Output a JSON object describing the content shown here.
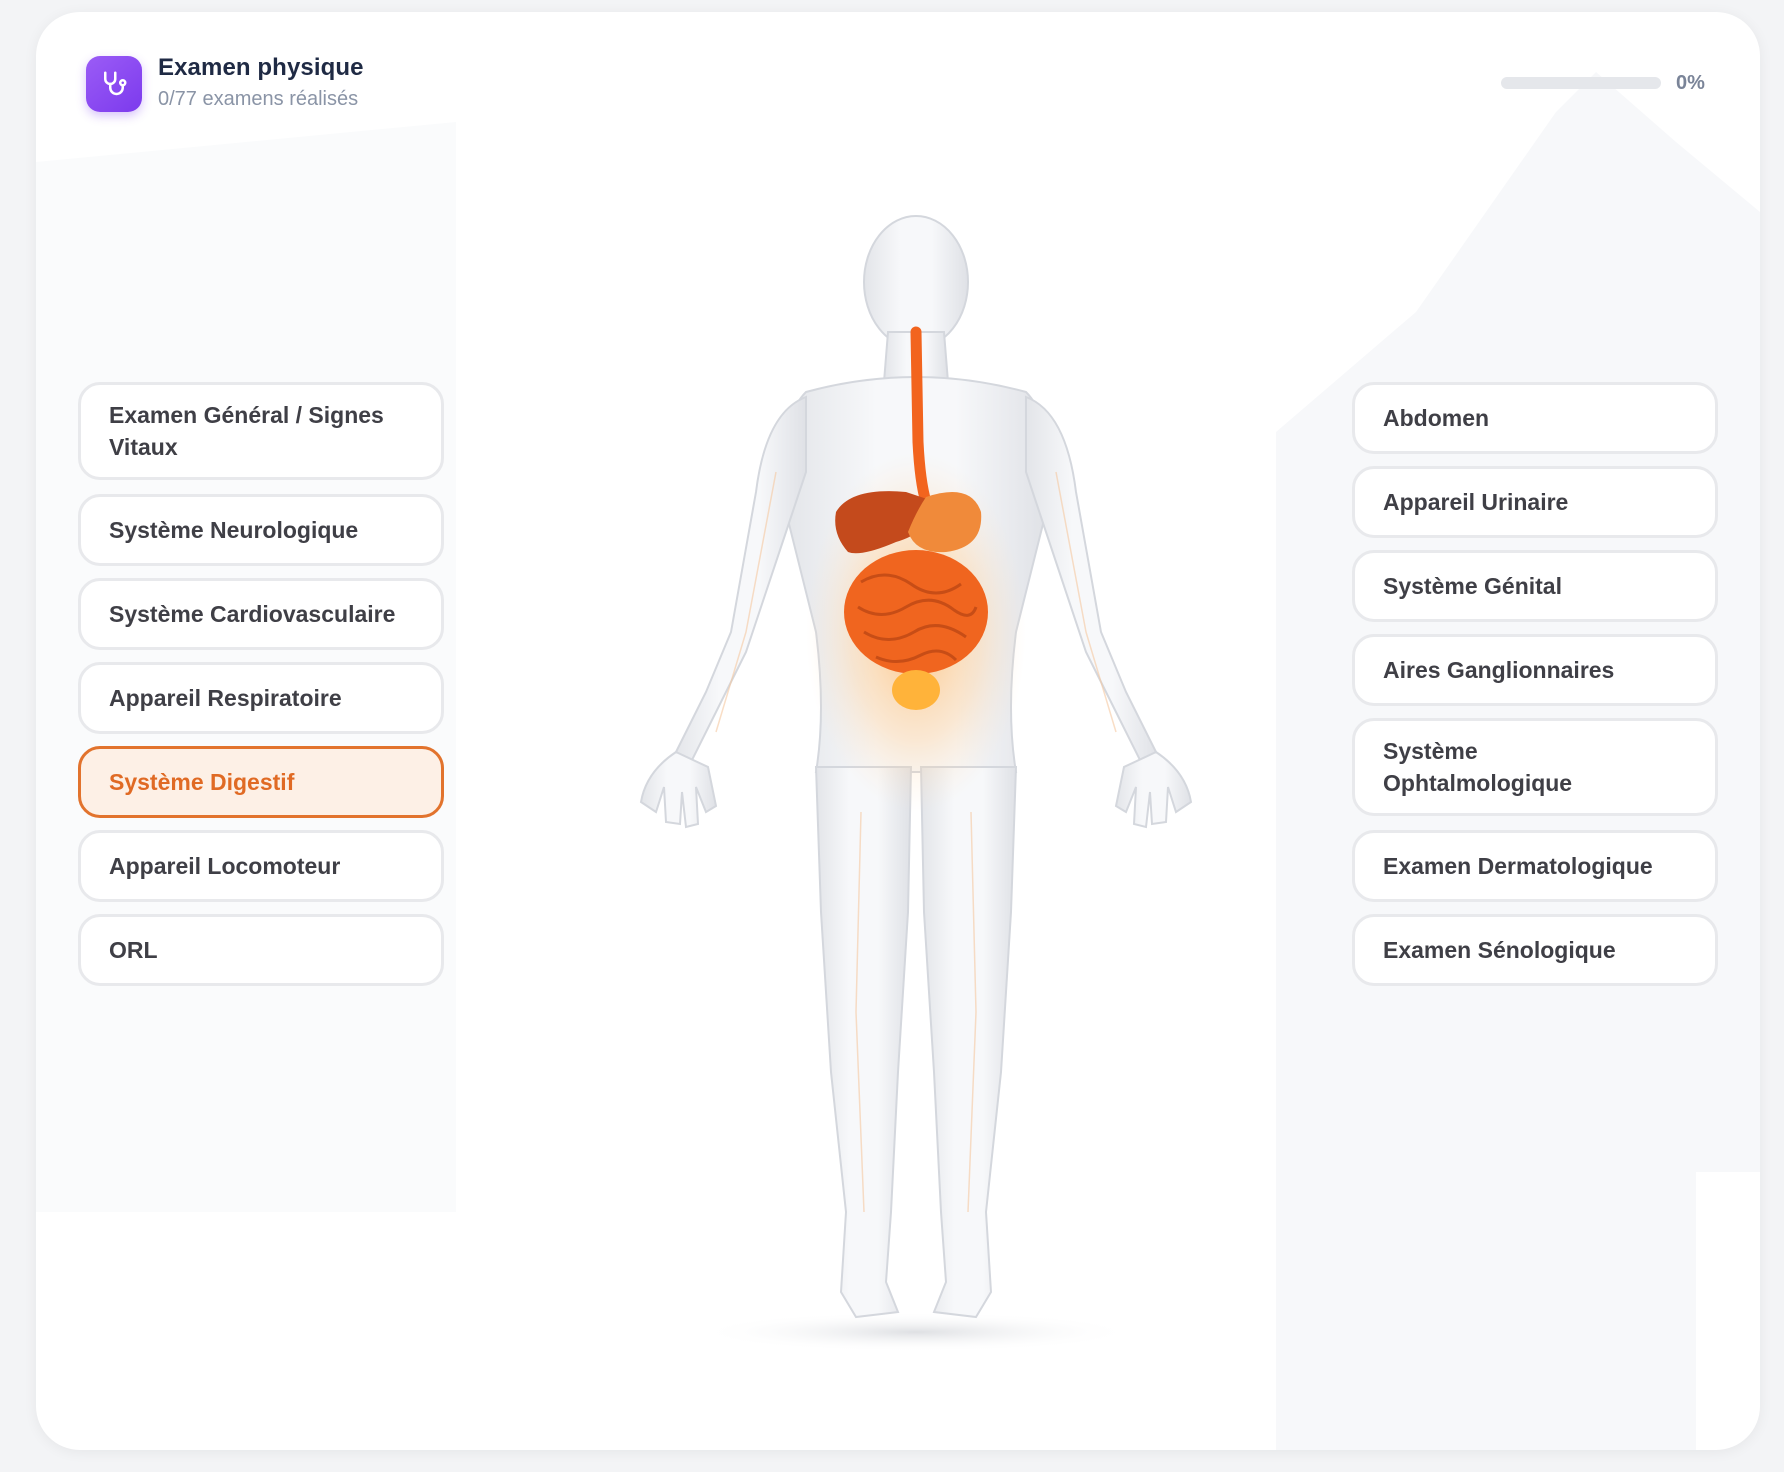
{
  "header": {
    "title": "Examen physique",
    "subtitle": "0/77 examens réalisés",
    "icon": "stethoscope-icon",
    "accent_color": "#7c3aed"
  },
  "progress": {
    "value": 0,
    "label": "0%"
  },
  "left_systems": [
    {
      "label": "Examen Général / Signes Vitaux",
      "active": false
    },
    {
      "label": "Système Neurologique",
      "active": false
    },
    {
      "label": "Système Cardiovasculaire",
      "active": false
    },
    {
      "label": "Appareil Respiratoire",
      "active": false
    },
    {
      "label": "Système Digestif",
      "active": true
    },
    {
      "label": "Appareil Locomoteur",
      "active": false
    },
    {
      "label": "ORL",
      "active": false
    }
  ],
  "right_systems": [
    {
      "label": "Abdomen",
      "active": false
    },
    {
      "label": "Appareil Urinaire",
      "active": false
    },
    {
      "label": "Système Génital",
      "active": false
    },
    {
      "label": "Aires Ganglionnaires",
      "active": false
    },
    {
      "label": "Système Ophtalmologique",
      "active": false
    },
    {
      "label": "Examen Dermatologique",
      "active": false
    },
    {
      "label": "Examen Sénologique",
      "active": false
    }
  ],
  "figure": {
    "highlighted_system": "digestive",
    "highlight_color": "#f2641e"
  }
}
